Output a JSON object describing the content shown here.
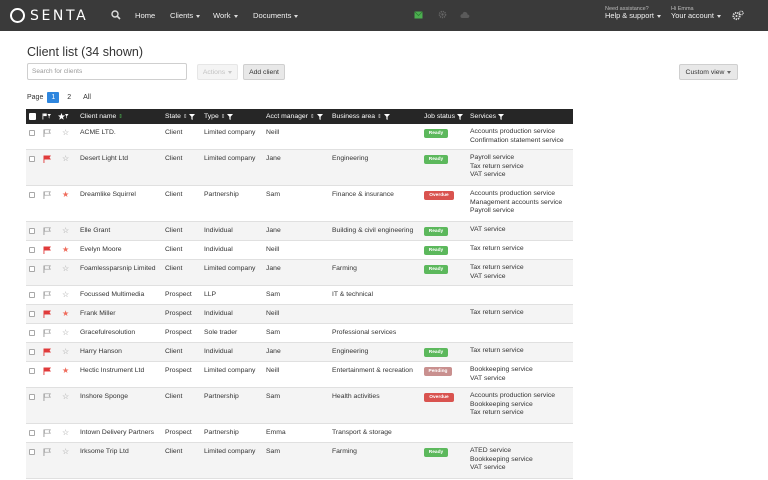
{
  "nav": {
    "logo": "SENTA",
    "items": [
      {
        "label": "Home"
      },
      {
        "label": "Clients"
      },
      {
        "label": "Work"
      },
      {
        "label": "Documents"
      }
    ],
    "assist_small": "Need assistance?",
    "assist_big": "Help & support",
    "user_small": "Hi Emma",
    "user_big": "Your account"
  },
  "page": {
    "title": "Client list (34 shown)",
    "search_placeholder": "Search for clients",
    "actions_label": "Actions",
    "add_client_label": "Add client",
    "custom_view_label": "Custom view",
    "pager_label": "Page",
    "pages": [
      "1",
      "2",
      "All"
    ]
  },
  "table": {
    "columns": {
      "client_name": "Client name",
      "state": "State",
      "type": "Type",
      "acct_manager": "Acct manager",
      "business_area": "Business area",
      "job_status": "Job status",
      "services": "Services"
    },
    "rows": [
      {
        "name": "ACME LTD.",
        "state": "Client",
        "type": "Limited company",
        "manager": "Neill",
        "area": "",
        "flagged": false,
        "starred": false,
        "status": "Ready",
        "status_kind": "ready",
        "services": [
          "Accounts production service",
          "Confirmation statement service"
        ]
      },
      {
        "name": "Desert Light Ltd",
        "state": "Client",
        "type": "Limited company",
        "manager": "Jane",
        "area": "Engineering",
        "flagged": true,
        "starred": false,
        "status": "Ready",
        "status_kind": "ready",
        "services": [
          "Payroll service",
          "Tax return service",
          "VAT service"
        ]
      },
      {
        "name": "Dreamlike Squirrel",
        "state": "Client",
        "type": "Partnership",
        "manager": "Sam",
        "area": "Finance & insurance",
        "flagged": false,
        "starred": true,
        "status": "Overdue",
        "status_kind": "overdue",
        "services": [
          "Accounts production service",
          "Management accounts service",
          "Payroll service"
        ]
      },
      {
        "name": "Elle Grant",
        "state": "Client",
        "type": "Individual",
        "manager": "Jane",
        "area": "Building & civil engineering",
        "flagged": false,
        "starred": false,
        "status": "Ready",
        "status_kind": "ready",
        "services": [
          "VAT service"
        ]
      },
      {
        "name": "Evelyn Moore",
        "state": "Client",
        "type": "Individual",
        "manager": "Neill",
        "area": "",
        "flagged": true,
        "starred": true,
        "status": "Ready",
        "status_kind": "ready",
        "services": [
          "Tax return service"
        ]
      },
      {
        "name": "Foamlessparsnip Limited",
        "state": "Client",
        "type": "Limited company",
        "manager": "Jane",
        "area": "Farming",
        "flagged": false,
        "starred": false,
        "status": "Ready",
        "status_kind": "ready",
        "services": [
          "Tax return service",
          "VAT service"
        ]
      },
      {
        "name": "Focussed Multimedia",
        "state": "Prospect",
        "type": "LLP",
        "manager": "Sam",
        "area": "IT & technical",
        "flagged": false,
        "starred": false,
        "status": "",
        "status_kind": "",
        "services": []
      },
      {
        "name": "Frank Miller",
        "state": "Prospect",
        "type": "Individual",
        "manager": "Neill",
        "area": "",
        "flagged": true,
        "starred": true,
        "status": "",
        "status_kind": "",
        "services": [
          "Tax return service"
        ]
      },
      {
        "name": "Gracefulresolution",
        "state": "Prospect",
        "type": "Sole trader",
        "manager": "Sam",
        "area": "Professional services",
        "flagged": false,
        "starred": false,
        "status": "",
        "status_kind": "",
        "services": []
      },
      {
        "name": "Harry Hanson",
        "state": "Client",
        "type": "Individual",
        "manager": "Jane",
        "area": "Engineering",
        "flagged": true,
        "starred": false,
        "status": "Ready",
        "status_kind": "ready",
        "services": [
          "Tax return service"
        ]
      },
      {
        "name": "Hectic Instrument Ltd",
        "state": "Prospect",
        "type": "Limited company",
        "manager": "Neill",
        "area": "Entertainment & recreation",
        "flagged": true,
        "starred": true,
        "status": "Pending",
        "status_kind": "pending",
        "services": [
          "Bookkeeping service",
          "VAT service"
        ]
      },
      {
        "name": "Inshore Sponge",
        "state": "Client",
        "type": "Partnership",
        "manager": "Sam",
        "area": "Health activities",
        "flagged": false,
        "starred": false,
        "status": "Overdue",
        "status_kind": "overdue",
        "services": [
          "Accounts production service",
          "Bookkeeping service",
          "Tax return service"
        ]
      },
      {
        "name": "Intown Delivery Partners",
        "state": "Prospect",
        "type": "Partnership",
        "manager": "Emma",
        "area": "Transport & storage",
        "flagged": false,
        "starred": false,
        "status": "",
        "status_kind": "",
        "services": []
      },
      {
        "name": "Irksome Trip Ltd",
        "state": "Client",
        "type": "Limited company",
        "manager": "Sam",
        "area": "Farming",
        "flagged": false,
        "starred": false,
        "status": "Ready",
        "status_kind": "ready",
        "services": [
          "ATED service",
          "Bookkeeping service",
          "VAT service"
        ]
      }
    ]
  }
}
